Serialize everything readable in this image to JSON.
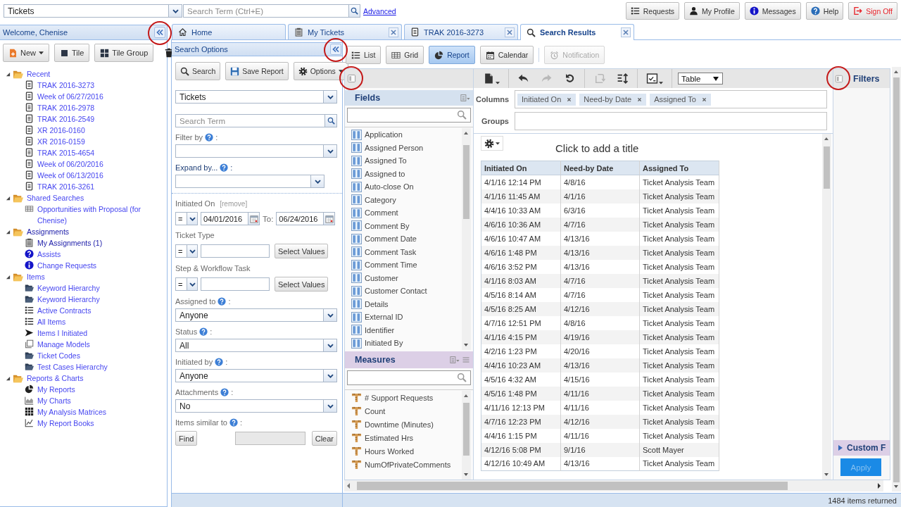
{
  "top_bar": {
    "module_select": "Tickets",
    "search": {
      "placeholder": "Search Term (Ctrl+E)"
    },
    "advanced_link": "Advanced",
    "buttons": [
      {
        "label": "Requests",
        "kind": "requests"
      },
      {
        "label": "My Profile",
        "kind": "profile"
      },
      {
        "label": "Messages",
        "kind": "messages"
      },
      {
        "label": "Help",
        "kind": "help"
      },
      {
        "label": "Sign Off",
        "kind": "sign-off"
      }
    ]
  },
  "sidebar": {
    "title": "Welcome, Chenise",
    "circled": true,
    "toolbar": [
      {
        "label": "New",
        "kind": "new",
        "menu": true
      },
      {
        "label": "Tile",
        "kind": "tile",
        "menu": false
      },
      {
        "label": "Tile Group",
        "kind": "tile-group",
        "menu": false
      },
      {
        "kind": "delete",
        "menu": false
      }
    ],
    "tree": [
      {
        "label": "Recent",
        "kind": "folder",
        "expanded": true,
        "active": false,
        "children": [
          {
            "label": "TRAK 2016-3273",
            "kind": "document",
            "active": false
          },
          {
            "label": "Week of 06/27/2016",
            "kind": "document",
            "active": false
          },
          {
            "label": "TRAK 2016-2978",
            "kind": "document",
            "active": false
          },
          {
            "label": "TRAK 2016-2549",
            "kind": "document",
            "active": false
          },
          {
            "label": "XR 2016-0160",
            "kind": "document",
            "active": false
          },
          {
            "label": "XR 2016-0159",
            "kind": "document",
            "active": false
          },
          {
            "label": "TRAK 2015-4654",
            "kind": "document",
            "active": false
          },
          {
            "label": "Week of 06/20/2016",
            "kind": "document",
            "active": false
          },
          {
            "label": "Week of 06/13/2016",
            "kind": "document",
            "active": false
          },
          {
            "label": "TRAK 2016-3261",
            "kind": "document",
            "active": false
          }
        ]
      },
      {
        "label": "Shared Searches",
        "kind": "folder",
        "expanded": true,
        "active": false,
        "children": [
          {
            "label": "Opportunities with Proposal (for Chenise)",
            "kind": "table",
            "active": false
          }
        ]
      },
      {
        "label": "Assignments",
        "kind": "folder",
        "expanded": true,
        "active": true,
        "children": [
          {
            "label": "My Assignments (1)",
            "kind": "clipboard",
            "active": true
          },
          {
            "label": "Assists",
            "kind": "question",
            "active": false
          },
          {
            "label": "Change Requests",
            "kind": "info",
            "active": false
          }
        ]
      },
      {
        "label": "Items",
        "kind": "folder",
        "expanded": true,
        "active": false,
        "children": [
          {
            "label": "Keyword Hierarchy",
            "kind": "dark-folder",
            "active": false
          },
          {
            "label": "Keyword Hierarchy",
            "kind": "dark-folder",
            "active": false
          },
          {
            "label": "Active Contracts",
            "kind": "list",
            "active": false
          },
          {
            "label": "All Items",
            "kind": "list",
            "active": false
          },
          {
            "label": "Items I Initiated",
            "kind": "arrow",
            "active": false
          },
          {
            "label": "Manage Models",
            "kind": "pages",
            "active": false
          },
          {
            "label": "Ticket Codes",
            "kind": "dark-folder",
            "active": false
          },
          {
            "label": "Test Cases Hierarchy",
            "kind": "dark-folder",
            "active": false
          }
        ]
      },
      {
        "label": "Reports & Charts",
        "kind": "folder",
        "expanded": true,
        "active": false,
        "children": [
          {
            "label": "My Reports",
            "kind": "pie",
            "active": false
          },
          {
            "label": "My Charts",
            "kind": "area-chart",
            "active": false
          },
          {
            "label": "My Analysis Matrices",
            "kind": "matrix",
            "active": false
          },
          {
            "label": "My Report Books",
            "kind": "line-chart",
            "active": false
          }
        ]
      }
    ]
  },
  "tabs": [
    {
      "label": "Home",
      "kind": "home",
      "closable": false,
      "selected": false
    },
    {
      "label": "My Tickets",
      "kind": "clipboard",
      "closable": true,
      "selected": false
    },
    {
      "label": "TRAK 2016-3273",
      "kind": "document",
      "closable": true,
      "selected": false
    },
    {
      "label": "Search Results",
      "kind": "search",
      "closable": true,
      "selected": true
    }
  ],
  "search_options": {
    "title": "Search Options",
    "circled": true,
    "buttons": [
      {
        "label": "Search",
        "kind": "search",
        "menu": false
      },
      {
        "label": "Save Report",
        "kind": "save",
        "menu": false
      },
      {
        "label": "Options",
        "kind": "options",
        "menu": true
      }
    ],
    "type_select": "Tickets",
    "search": {
      "placeholder": "Search Term"
    },
    "primary": [
      {
        "kind": "select",
        "label": "Filter by",
        "help": true,
        "suffix": ":",
        "emphasized": false
      },
      {
        "kind": "select",
        "label": "Expand by...",
        "help": true,
        "suffix": ":",
        "emphasized": true
      }
    ],
    "criteria": [
      {
        "kind": "date-range",
        "label": "Initiated On",
        "remove_link": "[remove]",
        "operator": "=",
        "from": "04/01/2016",
        "to_label": "To:",
        "to": "06/24/2016"
      },
      {
        "kind": "values",
        "label": "Ticket Type",
        "operator": "=",
        "button": "Select Values"
      },
      {
        "kind": "values",
        "label": "Step & Workflow Task",
        "operator": "=",
        "button": "Select Values"
      },
      {
        "kind": "select",
        "label": "Assigned to",
        "help": true,
        "suffix": ":",
        "value": "Anyone"
      },
      {
        "kind": "select",
        "label": "Status",
        "help": true,
        "suffix": ":",
        "value": "All"
      },
      {
        "kind": "select",
        "label": "Initiated by",
        "help": true,
        "suffix": ":",
        "value": "Anyone"
      },
      {
        "kind": "select",
        "label": "Attachments",
        "help": true,
        "suffix": ":",
        "value": "No"
      },
      {
        "kind": "similar",
        "label": "Items similar to",
        "help": true,
        "suffix": ":",
        "find": "Find",
        "clear": "Clear"
      }
    ]
  },
  "view_toolbar": {
    "views": [
      {
        "label": "List",
        "kind": "list",
        "selected": false
      },
      {
        "label": "Grid",
        "kind": "grid",
        "selected": false
      },
      {
        "label": "Report",
        "kind": "report",
        "selected": true
      },
      {
        "label": "Calendar",
        "kind": "calendar",
        "selected": false
      }
    ],
    "notification": {
      "label": "Notification",
      "disabled": true
    }
  },
  "fields_panel": {
    "circled": true,
    "fields": {
      "title": "Fields",
      "items": [
        "Application",
        "Assigned Person",
        "Assigned To",
        "Assigned to",
        "Auto-close On",
        "Category",
        "Comment",
        "Comment By",
        "Comment Date",
        "Comment Task",
        "Comment Time",
        "Customer",
        "Customer Contact",
        "Details",
        "External ID",
        "Identifier",
        "Initiated By"
      ]
    },
    "measures": {
      "title": "Measures",
      "items": [
        "# Support Requests",
        "Count",
        "Downtime (Minutes)",
        "Estimated Hrs",
        "Hours Worked",
        "NumOfPrivateComments"
      ]
    }
  },
  "report": {
    "tool_groups": [
      [
        {
          "kind": "export",
          "disabled": false,
          "menu": true
        }
      ],
      [
        {
          "kind": "undo",
          "disabled": false,
          "menu": false
        },
        {
          "kind": "redo",
          "disabled": true,
          "menu": false
        },
        {
          "kind": "reset",
          "disabled": false,
          "menu": false
        }
      ],
      [
        {
          "kind": "swap",
          "disabled": true,
          "menu": false
        },
        {
          "kind": "sort",
          "disabled": false,
          "menu": false
        }
      ],
      [
        {
          "kind": "checklist",
          "disabled": false,
          "menu": true
        }
      ]
    ],
    "display_select": "Table",
    "columns": {
      "label": "Columns",
      "chips": [
        "Initiated On",
        "Need-by Date",
        "Assigned To"
      ]
    },
    "groups": {
      "label": "Groups"
    },
    "title_prompt": "Click to add a title",
    "table": {
      "columns": [
        "Initiated On",
        "Need-by Date",
        "Assigned To"
      ],
      "rows": [
        [
          "4/1/16 12:14 PM",
          "4/8/16",
          "Ticket Analysis Team"
        ],
        [
          "4/1/16 11:45 AM",
          "4/1/16",
          "Ticket Analysis Team"
        ],
        [
          "4/4/16 10:33 AM",
          "6/3/16",
          "Ticket Analysis Team"
        ],
        [
          "4/6/16 10:36 AM",
          "4/7/16",
          "Ticket Analysis Team"
        ],
        [
          "4/6/16 10:47 AM",
          "4/13/16",
          "Ticket Analysis Team"
        ],
        [
          "4/6/16 1:48 PM",
          "4/13/16",
          "Ticket Analysis Team"
        ],
        [
          "4/6/16 3:52 PM",
          "4/13/16",
          "Ticket Analysis Team"
        ],
        [
          "4/1/16 8:03 AM",
          "4/7/16",
          "Ticket Analysis Team"
        ],
        [
          "4/5/16 8:14 AM",
          "4/7/16",
          "Ticket Analysis Team"
        ],
        [
          "4/5/16 8:25 AM",
          "4/12/16",
          "Ticket Analysis Team"
        ],
        [
          "4/7/16 12:51 PM",
          "4/8/16",
          "Ticket Analysis Team"
        ],
        [
          "4/1/16 4:15 PM",
          "4/19/16",
          "Ticket Analysis Team"
        ],
        [
          "4/2/16 1:23 PM",
          "4/20/16",
          "Ticket Analysis Team"
        ],
        [
          "4/4/16 10:23 AM",
          "4/13/16",
          "Ticket Analysis Team"
        ],
        [
          "4/5/16 4:32 AM",
          "4/15/16",
          "Ticket Analysis Team"
        ],
        [
          "4/5/16 1:48 PM",
          "4/11/16",
          "Ticket Analysis Team"
        ],
        [
          "4/11/16 12:13 PM",
          "4/11/16",
          "Ticket Analysis Team"
        ],
        [
          "4/7/16 12:23 PM",
          "4/12/16",
          "Ticket Analysis Team"
        ],
        [
          "4/4/16 1:15 PM",
          "4/11/16",
          "Ticket Analysis Team"
        ],
        [
          "4/12/16 5:08 PM",
          "9/1/16",
          "Scott Mayer"
        ],
        [
          "4/12/16 10:49 AM",
          "4/13/16",
          "Ticket Analysis Team"
        ]
      ]
    }
  },
  "filters_panel": {
    "title": "Filters",
    "circled": true,
    "sections": [
      {
        "title": "Custom F",
        "expanded": false
      }
    ],
    "apply": {
      "label": "Apply",
      "disabled": true
    }
  },
  "status_bar": {
    "text": "1484 items returned"
  }
}
